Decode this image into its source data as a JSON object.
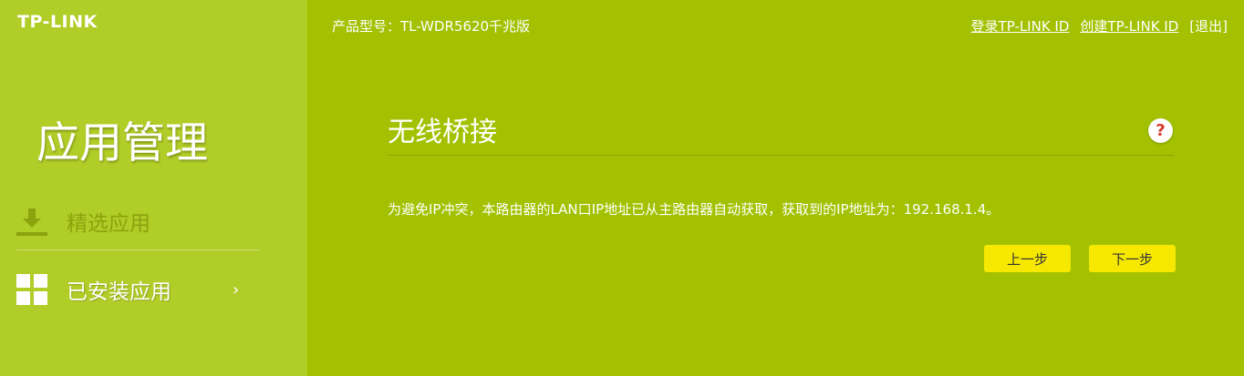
{
  "brand": {
    "logo_text": "TP-LINK"
  },
  "header": {
    "product_model": "产品型号：TL-WDR5620千兆版",
    "links": {
      "login": "登录TP-LINK ID",
      "create": "创建TP-LINK ID",
      "logout": "[退出]"
    }
  },
  "sidebar": {
    "title": "应用管理",
    "items": [
      {
        "label": "精选应用",
        "icon": "download-icon",
        "active": false
      },
      {
        "label": "已安装应用",
        "icon": "grid-icon",
        "active": true,
        "chevron": "›"
      }
    ]
  },
  "main": {
    "title": "无线桥接",
    "help_icon": "?",
    "message": "为避免IP冲突，本路由器的LAN口IP地址已从主路由器自动获取，获取到的IP地址为：192.168.1.4。",
    "buttons": {
      "prev": "上一步",
      "next": "下一步"
    }
  },
  "colors": {
    "background": "#a3c100",
    "sidebar": "#b1cd27",
    "button": "#f6e800",
    "help_mark": "#d93a2b"
  }
}
